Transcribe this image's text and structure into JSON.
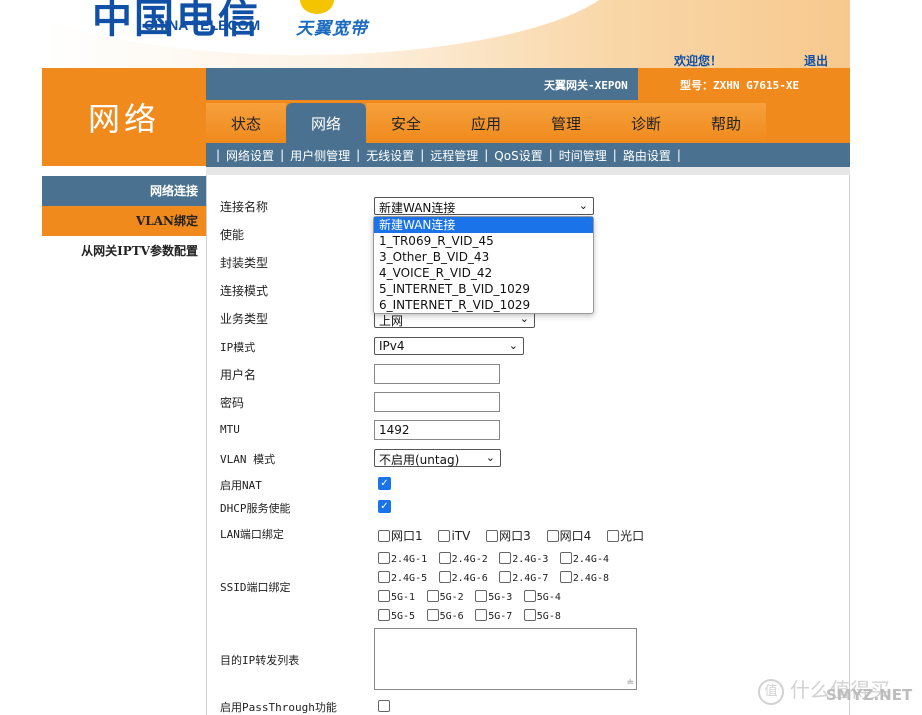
{
  "header": {
    "logo_mark": "中国电信",
    "logo_text": "CHINA TELECOM",
    "brand_text": "天翼宽带",
    "welcome": "欢迎您！",
    "logout": "退出"
  },
  "infobar": {
    "gateway": "天翼网关-XEPON",
    "model": "型号：ZXHN G7615-XE"
  },
  "section_title": "网络",
  "tabs": [
    {
      "label": "状态",
      "active": false
    },
    {
      "label": "网络",
      "active": true
    },
    {
      "label": "安全",
      "active": false
    },
    {
      "label": "应用",
      "active": false
    },
    {
      "label": "管理",
      "active": false
    },
    {
      "label": "诊断",
      "active": false
    },
    {
      "label": "帮助",
      "active": false
    }
  ],
  "subnav": [
    "网络设置",
    "用户侧管理",
    "无线设置",
    "远程管理",
    "QoS设置",
    "时间管理",
    "路由设置"
  ],
  "leftmenu": [
    {
      "label": "网络连接",
      "active": true
    },
    {
      "label": "VLAN绑定",
      "active": false
    },
    {
      "label": "从网关IPTV参数配置",
      "active": false
    }
  ],
  "form": {
    "connection_name_label": "连接名称",
    "connection_name_value": "新建WAN连接",
    "enable_label": "使能",
    "encap_label": "封装类型",
    "conn_mode_label": "连接模式",
    "service_label": "业务类型",
    "service_value": "上网",
    "ip_mode_label": "IP模式",
    "ip_mode_value": "IPv4",
    "username_label": "用户名",
    "username_value": "",
    "password_label": "密码",
    "password_value": "",
    "mtu_label": "MTU",
    "mtu_value": "1492",
    "vlan_mode_label": "VLAN 模式",
    "vlan_mode_value": "不启用(untag)",
    "nat_label": "启用NAT",
    "nat_checked": true,
    "dhcp_label": "DHCP服务使能",
    "dhcp_checked": true,
    "lan_bind_label": "LAN端口绑定",
    "lan_ports": [
      "网口1",
      "iTV",
      "网口3",
      "网口4",
      "光口"
    ],
    "ssid_bind_label": "SSID端口绑定",
    "ssid_24": [
      "2.4G-1",
      "2.4G-2",
      "2.4G-3",
      "2.4G-4",
      "2.4G-5",
      "2.4G-6",
      "2.4G-7",
      "2.4G-8"
    ],
    "ssid_5": [
      "5G-1",
      "5G-2",
      "5G-3",
      "5G-4",
      "5G-5",
      "5G-6",
      "5G-7",
      "5G-8"
    ],
    "dest_ip_label": "目的IP转发列表",
    "passthrough_label": "启用PassThrough功能"
  },
  "dropdown": {
    "options": [
      "新建WAN连接",
      "1_TR069_R_VID_45",
      "3_Other_B_VID_43",
      "4_VOICE_R_VID_42",
      "5_INTERNET_B_VID_1029",
      "6_INTERNET_R_VID_1029"
    ],
    "selected_index": 0
  },
  "watermark": {
    "icon": "值",
    "text": "什么值得买",
    "site": "SMYZ.NET"
  },
  "colors": {
    "orange": "#f08a1c",
    "steel_blue": "#4a7290",
    "select_blue": "#1a73e8",
    "telecom_blue": "#1050a6"
  }
}
